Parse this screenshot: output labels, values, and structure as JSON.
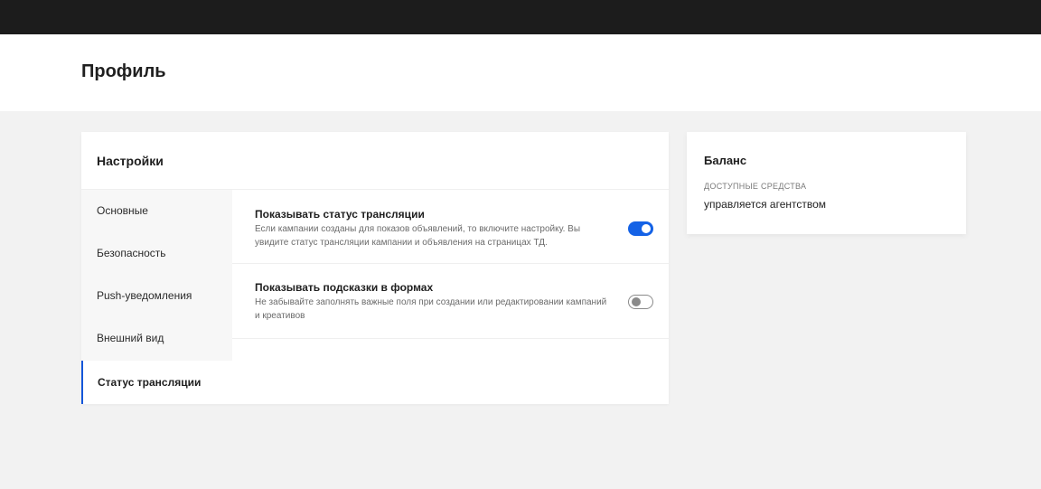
{
  "header": {
    "title": "Профиль"
  },
  "settings": {
    "title": "Настройки",
    "nav": [
      {
        "label": "Основные"
      },
      {
        "label": "Безопасность"
      },
      {
        "label": "Push-уведомления"
      },
      {
        "label": "Внешний вид"
      },
      {
        "label": "Статус трансляции",
        "active": true
      }
    ],
    "options": [
      {
        "title": "Показывать статус трансляции",
        "description": "Если кампании созданы для показов объявлений, то включите настройку. Вы увидите статус трансляции кампании и объявления на страницах ТД.",
        "enabled": true
      },
      {
        "title": "Показывать подсказки в формах",
        "description": "Не забывайте заполнять важные поля при создании или редактировании кампаний и креативов",
        "enabled": false
      }
    ]
  },
  "balance": {
    "title": "Баланс",
    "label": "ДОСТУПНЫЕ СРЕДСТВА",
    "value": "управляется агентством"
  },
  "colors": {
    "accent": "#1462e6",
    "topbar": "#1c1c1c",
    "background": "#f2f2f2"
  }
}
